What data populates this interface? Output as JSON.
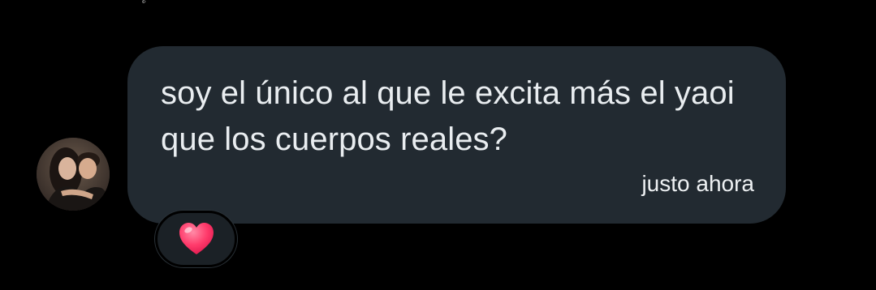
{
  "status": {
    "top_glyph": "ะ"
  },
  "message": {
    "text": "soy el único al que le excita más el yaoi que los cuerpos reales?",
    "timestamp": "justo ahora"
  },
  "sender": {
    "avatar_icon": "profile-photo-avatar"
  },
  "reaction": {
    "icon": "heart-icon",
    "color": "#ff3b6b"
  },
  "colors": {
    "background": "#000000",
    "bubble": "#222a31",
    "text": "#e9edf0"
  }
}
